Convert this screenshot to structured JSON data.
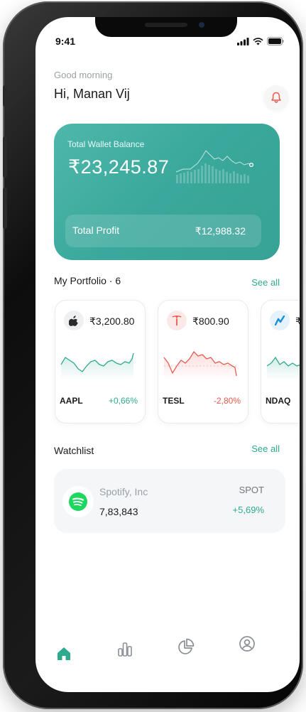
{
  "status_bar": {
    "time": "9:41"
  },
  "header": {
    "greeting": "Good morning",
    "user_name": "Hi,  Manan Vij"
  },
  "wallet": {
    "label": "Total Wallet Balance",
    "balance": "₹23,245.87",
    "profit_label": "Total Profit",
    "profit_value": "₹12,988.32"
  },
  "portfolio": {
    "title": "My Portfolio · 6",
    "see_all": "See all",
    "items": [
      {
        "ticker": "AAPL",
        "price": "₹3,200.80",
        "change": "+0,66%",
        "trend_color": "#2eaa8e"
      },
      {
        "ticker": "TESL",
        "price": "₹800.90",
        "change": "-2,80%",
        "trend_color": "#e8594f"
      },
      {
        "ticker": "NDAQ",
        "price": "₹",
        "change": "",
        "trend_color": "#2eaa8e"
      }
    ]
  },
  "watchlist": {
    "title": "Watchlist",
    "see_all": "See all",
    "items": [
      {
        "name": "Spotify, Inc",
        "value": "7,83,843",
        "ticker": "SPOT",
        "change": "+5,69%"
      }
    ]
  },
  "nav": {
    "items": [
      {
        "icon": "home-icon",
        "active": true
      },
      {
        "icon": "bar-chart-icon",
        "active": false
      },
      {
        "icon": "pie-chart-icon",
        "active": false
      },
      {
        "icon": "profile-icon",
        "active": false
      }
    ]
  },
  "colors": {
    "accent": "#2eaa8e",
    "card": "#3aa89c",
    "negative": "#e8594f"
  }
}
